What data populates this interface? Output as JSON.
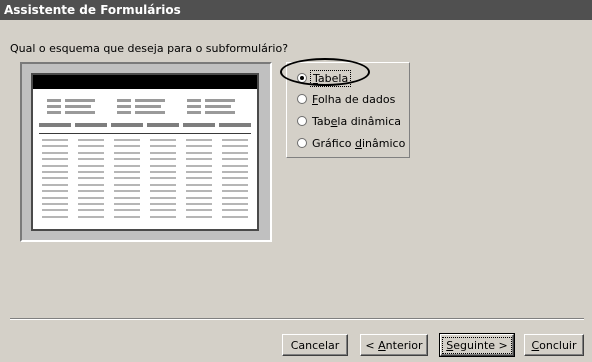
{
  "window": {
    "title": "Assistente de Formulários"
  },
  "question": "Qual o esquema que deseja para o subformulário?",
  "options": [
    {
      "prefix": "",
      "mnemonic": "T",
      "suffix": "abela",
      "checked": true
    },
    {
      "prefix": "",
      "mnemonic": "F",
      "suffix": "olha de dados",
      "checked": false
    },
    {
      "prefix": "Tab",
      "mnemonic": "e",
      "suffix": "la dinâmica",
      "checked": false
    },
    {
      "prefix": "Gráfico ",
      "mnemonic": "d",
      "suffix": "inâmico",
      "checked": false
    }
  ],
  "buttons": {
    "cancel": {
      "label": "Cancelar"
    },
    "back": {
      "prefix": "< ",
      "mnemonic": "A",
      "suffix": "nterior"
    },
    "next": {
      "prefix": "",
      "mnemonic": "S",
      "suffix": "eguinte >"
    },
    "finish": {
      "prefix": "",
      "mnemonic": "C",
      "suffix": "oncluir"
    }
  },
  "colors": {
    "titlebar": "#505050",
    "dialog": "#d4d0c8"
  }
}
